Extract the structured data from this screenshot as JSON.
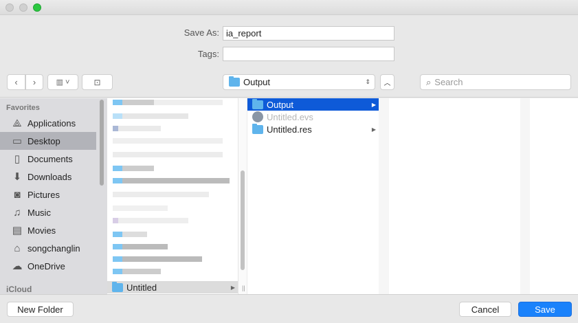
{
  "window": {
    "traffic_lights": [
      "close",
      "minimize",
      "zoom"
    ]
  },
  "form": {
    "save_as_label": "Save As:",
    "save_as_value": "ia_report",
    "tags_label": "Tags:",
    "tags_value": ""
  },
  "toolbar": {
    "location": "Output",
    "search_placeholder": "Search"
  },
  "sidebar": {
    "favorites_header": "Favorites",
    "items": [
      {
        "label": "Applications",
        "icon": "applications-icon"
      },
      {
        "label": "Desktop",
        "icon": "desktop-icon",
        "selected": true
      },
      {
        "label": "Documents",
        "icon": "documents-icon"
      },
      {
        "label": "Downloads",
        "icon": "downloads-icon"
      },
      {
        "label": "Pictures",
        "icon": "pictures-icon"
      },
      {
        "label": "Music",
        "icon": "music-icon"
      },
      {
        "label": "Movies",
        "icon": "movies-icon"
      },
      {
        "label": "songchanglin",
        "icon": "home-icon"
      },
      {
        "label": "OneDrive",
        "icon": "cloud-icon"
      }
    ],
    "icloud_header": "iCloud"
  },
  "column1": {
    "selected_item": "Untitled"
  },
  "column2": {
    "items": [
      {
        "label": "Output",
        "selected": true
      },
      {
        "label": "Untitled.evs",
        "disabled": true
      },
      {
        "label": "Untitled.res"
      }
    ]
  },
  "buttons": {
    "new_folder": "New Folder",
    "cancel": "Cancel",
    "save": "Save"
  },
  "colors": {
    "accent": "#1a82fb",
    "selection": "#0e5ad8"
  }
}
